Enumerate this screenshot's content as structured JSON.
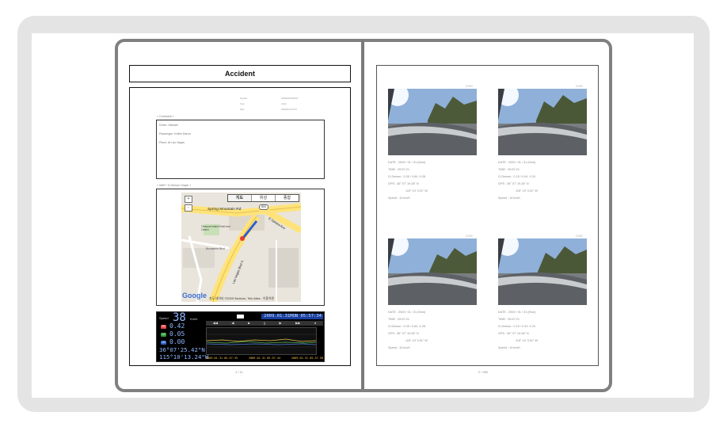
{
  "left_page": {
    "title": "Accident",
    "meta_lines": [
      {
        "label": "Number",
        "value": "000000001/0000/7"
      },
      {
        "label": "Type",
        "value": "Crash"
      },
      {
        "label": "Date",
        "value": "2009/01/31 05:57"
      }
    ],
    "comment_section_label": "< Comment >",
    "comment_lines": [
      "Driver: Michael",
      "Passenger: Kellen Baron",
      "Place: At Las Vegas"
    ],
    "map_section_label": "< MAP / G-Sensor Graph >",
    "map": {
      "tabs": [
        "지도",
        "위성",
        "종합"
      ],
      "zoom_in": "+",
      "zoom_out": "-",
      "road_labels": {
        "spring_mountain": "Spring Mountain Rd",
        "e_sahara": "E Sahara Ave",
        "las_vegas": "Las Vegas Blvd S",
        "treasure_island": "Treasure Island Hotel and Casino",
        "buccaneer": "Buccaneer Blvd",
        "shield": "604"
      },
      "logo": "Google",
      "copyright": "지도 데이터 ©2009 Sanborn, Tele Atlas - 이용약관"
    },
    "hud": {
      "speed_label": "Speed",
      "speed_value": "38",
      "speed_unit": "Km/h",
      "gsensor": [
        {
          "icon": "FB",
          "value": "0.42",
          "color": "#e04848"
        },
        {
          "icon": "LR",
          "value": "0.05",
          "color": "#2e9e3e"
        },
        {
          "icon": "UD",
          "value": "0.00",
          "color": "#2d63c9"
        }
      ],
      "lat": "36°07'25.42\"N",
      "lon": "115°10'13.24\"W",
      "timestamp": "2009.01.31MON 05:57:34",
      "controls": [
        "◀◀",
        "◀",
        "■",
        "||",
        "▶",
        "▶▶",
        "●"
      ],
      "times": [
        "2009.01.31 05.57.33",
        "2009.01.31 05.57.44",
        "2009.01.31 05.57.58"
      ]
    },
    "page_number": "1 / 11"
  },
  "right_page": {
    "page_number": "2 / 300",
    "thumbnails": [
      {
        "file": "CH03",
        "lines": [
          "DATE : 2009 / 01 / 31  (Mon)",
          "TIME : 05:57:21",
          "G-Sensor : 0.05 / 0.84 -0.28",
          "GPS : 36° 07' 19.28\" N",
          "115° 10' 3.91\" W",
          "Speed : 10 km/h"
        ]
      },
      {
        "file": "CH03",
        "lines": [
          "DATE : 2009 / 01 / 31  (Mon)",
          "TIME : 05:57:21",
          "G-Sensor : 0.15 / 0.04 -0.24",
          "GPS : 36° 07' 19.28\" N",
          "115° 10' 3.91\" W",
          "Speed : 10 km/h"
        ]
      },
      {
        "file": "CH03",
        "lines": [
          "DATE : 2009 / 01 / 31  (Mon)",
          "TIME : 05:57:21",
          "G-Sensor : 0.05 / 0.84 -0.28",
          "GPS : 36° 07' 19.28\" N",
          "115° 10' 3.91\" W",
          "Speed : 10 km/h"
        ]
      },
      {
        "file": "CH03",
        "lines": [
          "DATE : 2009 / 01 / 31  (Mon)",
          "TIME : 05:57:21",
          "G-Sensor : 0.15 / 0.04 -0.24",
          "GPS : 36° 07' 19.28\" N",
          "115° 10' 3.91\" W",
          "Speed : 10 km/h"
        ]
      }
    ]
  }
}
